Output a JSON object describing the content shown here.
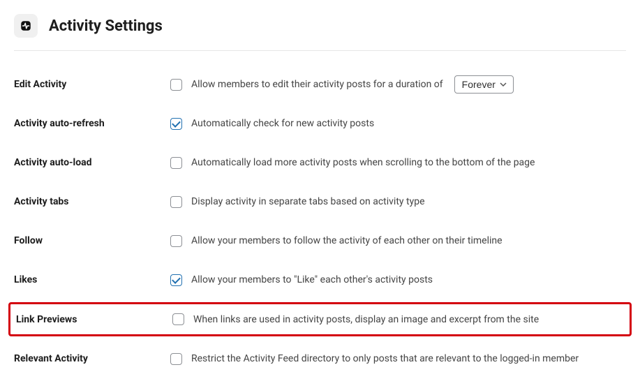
{
  "page": {
    "title": "Activity Settings"
  },
  "settings": {
    "edit_activity": {
      "label": "Edit Activity",
      "desc": "Allow members to edit their activity posts for a duration of",
      "checked": false,
      "select_value": "Forever"
    },
    "auto_refresh": {
      "label": "Activity auto-refresh",
      "desc": "Automatically check for new activity posts",
      "checked": true
    },
    "auto_load": {
      "label": "Activity auto-load",
      "desc": "Automatically load more activity posts when scrolling to the bottom of the page",
      "checked": false
    },
    "tabs": {
      "label": "Activity tabs",
      "desc": "Display activity in separate tabs based on activity type",
      "checked": false
    },
    "follow": {
      "label": "Follow",
      "desc": "Allow your members to follow the activity of each other on their timeline",
      "checked": false
    },
    "likes": {
      "label": "Likes",
      "desc": "Allow your members to \"Like\" each other's activity posts",
      "checked": true
    },
    "link_previews": {
      "label": "Link Previews",
      "desc": "When links are used in activity posts, display an image and excerpt from the site",
      "checked": false
    },
    "relevant": {
      "label": "Relevant Activity",
      "desc": "Restrict the Activity Feed directory to only posts that are relevant to the logged-in member",
      "checked": false
    }
  }
}
